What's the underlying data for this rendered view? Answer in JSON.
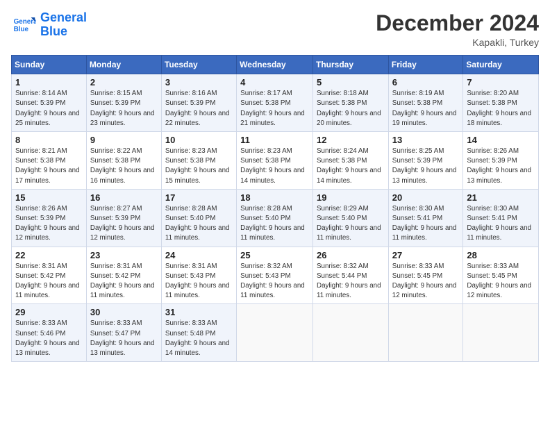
{
  "header": {
    "logo_line1": "General",
    "logo_line2": "Blue",
    "month": "December 2024",
    "location": "Kapakli, Turkey"
  },
  "weekdays": [
    "Sunday",
    "Monday",
    "Tuesday",
    "Wednesday",
    "Thursday",
    "Friday",
    "Saturday"
  ],
  "weeks": [
    [
      {
        "day": "1",
        "sunrise": "8:14 AM",
        "sunset": "5:39 PM",
        "daylight": "9 hours and 25 minutes."
      },
      {
        "day": "2",
        "sunrise": "8:15 AM",
        "sunset": "5:39 PM",
        "daylight": "9 hours and 23 minutes."
      },
      {
        "day": "3",
        "sunrise": "8:16 AM",
        "sunset": "5:39 PM",
        "daylight": "9 hours and 22 minutes."
      },
      {
        "day": "4",
        "sunrise": "8:17 AM",
        "sunset": "5:38 PM",
        "daylight": "9 hours and 21 minutes."
      },
      {
        "day": "5",
        "sunrise": "8:18 AM",
        "sunset": "5:38 PM",
        "daylight": "9 hours and 20 minutes."
      },
      {
        "day": "6",
        "sunrise": "8:19 AM",
        "sunset": "5:38 PM",
        "daylight": "9 hours and 19 minutes."
      },
      {
        "day": "7",
        "sunrise": "8:20 AM",
        "sunset": "5:38 PM",
        "daylight": "9 hours and 18 minutes."
      }
    ],
    [
      {
        "day": "8",
        "sunrise": "8:21 AM",
        "sunset": "5:38 PM",
        "daylight": "9 hours and 17 minutes."
      },
      {
        "day": "9",
        "sunrise": "8:22 AM",
        "sunset": "5:38 PM",
        "daylight": "9 hours and 16 minutes."
      },
      {
        "day": "10",
        "sunrise": "8:23 AM",
        "sunset": "5:38 PM",
        "daylight": "9 hours and 15 minutes."
      },
      {
        "day": "11",
        "sunrise": "8:23 AM",
        "sunset": "5:38 PM",
        "daylight": "9 hours and 14 minutes."
      },
      {
        "day": "12",
        "sunrise": "8:24 AM",
        "sunset": "5:38 PM",
        "daylight": "9 hours and 14 minutes."
      },
      {
        "day": "13",
        "sunrise": "8:25 AM",
        "sunset": "5:39 PM",
        "daylight": "9 hours and 13 minutes."
      },
      {
        "day": "14",
        "sunrise": "8:26 AM",
        "sunset": "5:39 PM",
        "daylight": "9 hours and 13 minutes."
      }
    ],
    [
      {
        "day": "15",
        "sunrise": "8:26 AM",
        "sunset": "5:39 PM",
        "daylight": "9 hours and 12 minutes."
      },
      {
        "day": "16",
        "sunrise": "8:27 AM",
        "sunset": "5:39 PM",
        "daylight": "9 hours and 12 minutes."
      },
      {
        "day": "17",
        "sunrise": "8:28 AM",
        "sunset": "5:40 PM",
        "daylight": "9 hours and 11 minutes."
      },
      {
        "day": "18",
        "sunrise": "8:28 AM",
        "sunset": "5:40 PM",
        "daylight": "9 hours and 11 minutes."
      },
      {
        "day": "19",
        "sunrise": "8:29 AM",
        "sunset": "5:40 PM",
        "daylight": "9 hours and 11 minutes."
      },
      {
        "day": "20",
        "sunrise": "8:30 AM",
        "sunset": "5:41 PM",
        "daylight": "9 hours and 11 minutes."
      },
      {
        "day": "21",
        "sunrise": "8:30 AM",
        "sunset": "5:41 PM",
        "daylight": "9 hours and 11 minutes."
      }
    ],
    [
      {
        "day": "22",
        "sunrise": "8:31 AM",
        "sunset": "5:42 PM",
        "daylight": "9 hours and 11 minutes."
      },
      {
        "day": "23",
        "sunrise": "8:31 AM",
        "sunset": "5:42 PM",
        "daylight": "9 hours and 11 minutes."
      },
      {
        "day": "24",
        "sunrise": "8:31 AM",
        "sunset": "5:43 PM",
        "daylight": "9 hours and 11 minutes."
      },
      {
        "day": "25",
        "sunrise": "8:32 AM",
        "sunset": "5:43 PM",
        "daylight": "9 hours and 11 minutes."
      },
      {
        "day": "26",
        "sunrise": "8:32 AM",
        "sunset": "5:44 PM",
        "daylight": "9 hours and 11 minutes."
      },
      {
        "day": "27",
        "sunrise": "8:33 AM",
        "sunset": "5:45 PM",
        "daylight": "9 hours and 12 minutes."
      },
      {
        "day": "28",
        "sunrise": "8:33 AM",
        "sunset": "5:45 PM",
        "daylight": "9 hours and 12 minutes."
      }
    ],
    [
      {
        "day": "29",
        "sunrise": "8:33 AM",
        "sunset": "5:46 PM",
        "daylight": "9 hours and 13 minutes."
      },
      {
        "day": "30",
        "sunrise": "8:33 AM",
        "sunset": "5:47 PM",
        "daylight": "9 hours and 13 minutes."
      },
      {
        "day": "31",
        "sunrise": "8:33 AM",
        "sunset": "5:48 PM",
        "daylight": "9 hours and 14 minutes."
      },
      null,
      null,
      null,
      null
    ]
  ]
}
